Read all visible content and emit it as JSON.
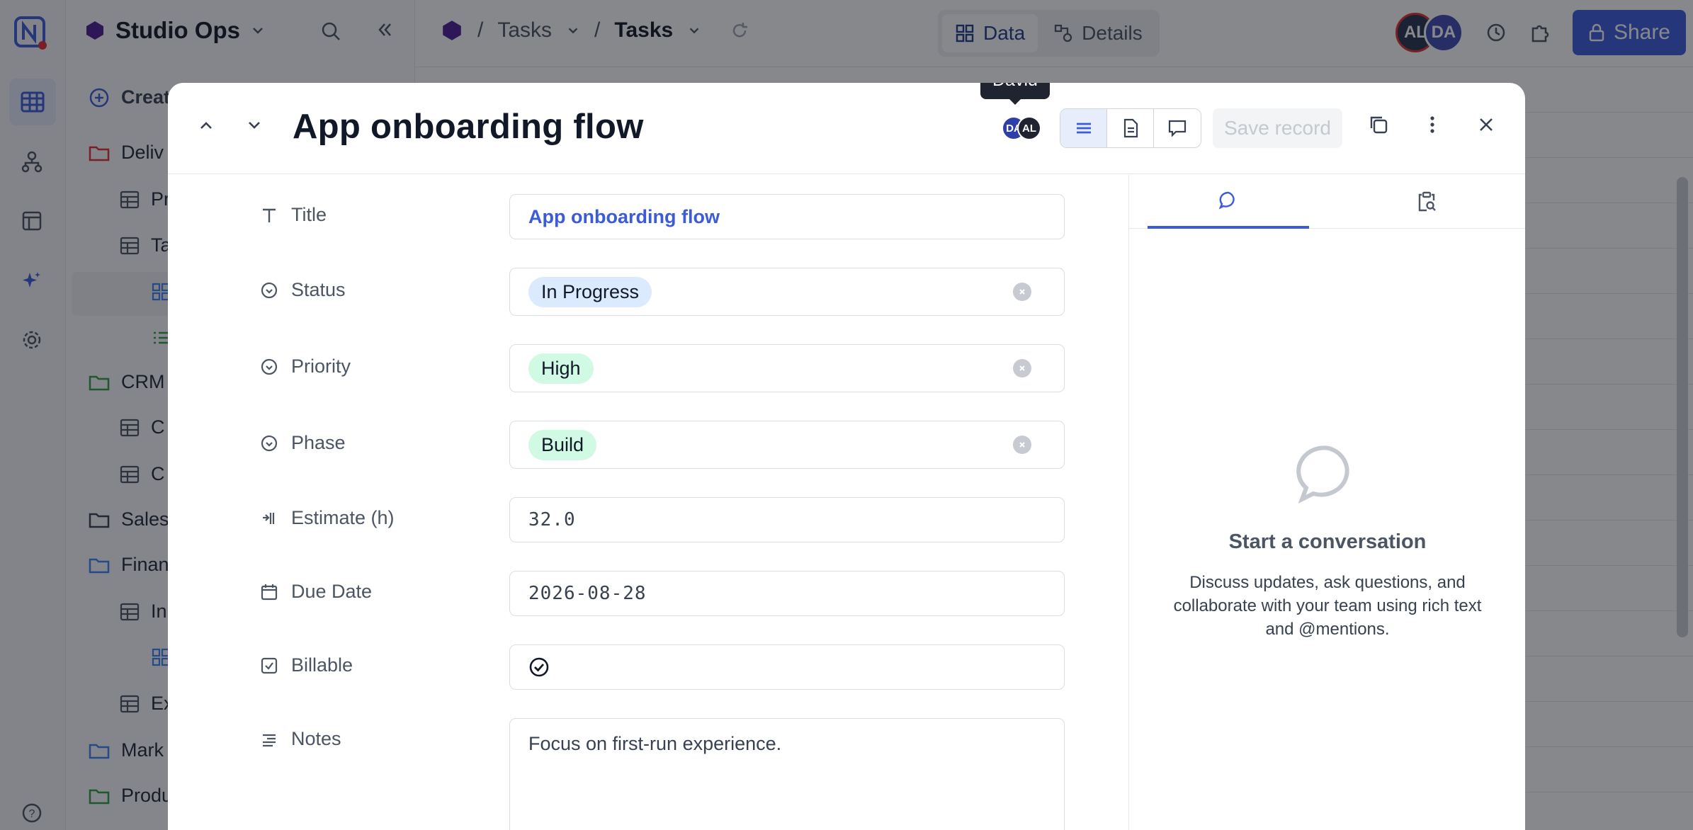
{
  "app": {
    "workspace": "Studio Ops",
    "create_label": "Create",
    "tree": [
      {
        "label": "Deliv",
        "kind": "folder-red"
      },
      {
        "label": "Pr",
        "kind": "table"
      },
      {
        "label": "Ta",
        "kind": "table"
      },
      {
        "label": "",
        "kind": "grid-view"
      },
      {
        "label": "",
        "kind": "list-view"
      },
      {
        "label": "CRM",
        "kind": "folder-green"
      },
      {
        "label": "C",
        "kind": "table"
      },
      {
        "label": "C",
        "kind": "table"
      },
      {
        "label": "Sales",
        "kind": "folder"
      },
      {
        "label": "Finan",
        "kind": "folder-blue"
      },
      {
        "label": "In",
        "kind": "table"
      },
      {
        "label": "",
        "kind": "grid-view"
      },
      {
        "label": "Ex",
        "kind": "table"
      },
      {
        "label": "Mark",
        "kind": "folder-blue"
      },
      {
        "label": "Produ",
        "kind": "folder-green"
      }
    ],
    "breadcrumb": {
      "part1": "Tasks",
      "part2": "Tasks"
    },
    "view_toggle": {
      "data": "Data",
      "details": "Details"
    },
    "avatars": [
      "AL",
      "DA"
    ],
    "share_label": "Share",
    "colors": {
      "accent": "#3b5bdb",
      "avatar_al": "#24324f",
      "avatar_da": "#3f4bb3"
    }
  },
  "modal": {
    "title": "App onboarding flow",
    "avatars": [
      "DA",
      "AL"
    ],
    "tooltip": "David",
    "save_label": "Save record",
    "fields": {
      "title": {
        "label": "Title",
        "value": "App onboarding flow"
      },
      "status": {
        "label": "Status",
        "value": "In Progress",
        "color": "#dbeafe"
      },
      "priority": {
        "label": "Priority",
        "value": "High",
        "color": "#d1fae5"
      },
      "phase": {
        "label": "Phase",
        "value": "Build",
        "color": "#d1fae5"
      },
      "estimate": {
        "label": "Estimate (h)",
        "value": "32.0"
      },
      "due_date": {
        "label": "Due Date",
        "value": "2026-08-28"
      },
      "billable": {
        "label": "Billable",
        "checked": true
      },
      "notes": {
        "label": "Notes",
        "value": "Focus on first-run experience."
      }
    },
    "comments": {
      "empty_title": "Start a conversation",
      "empty_text": "Discuss updates, ask questions, and collaborate with your team using rich text and @mentions."
    }
  }
}
